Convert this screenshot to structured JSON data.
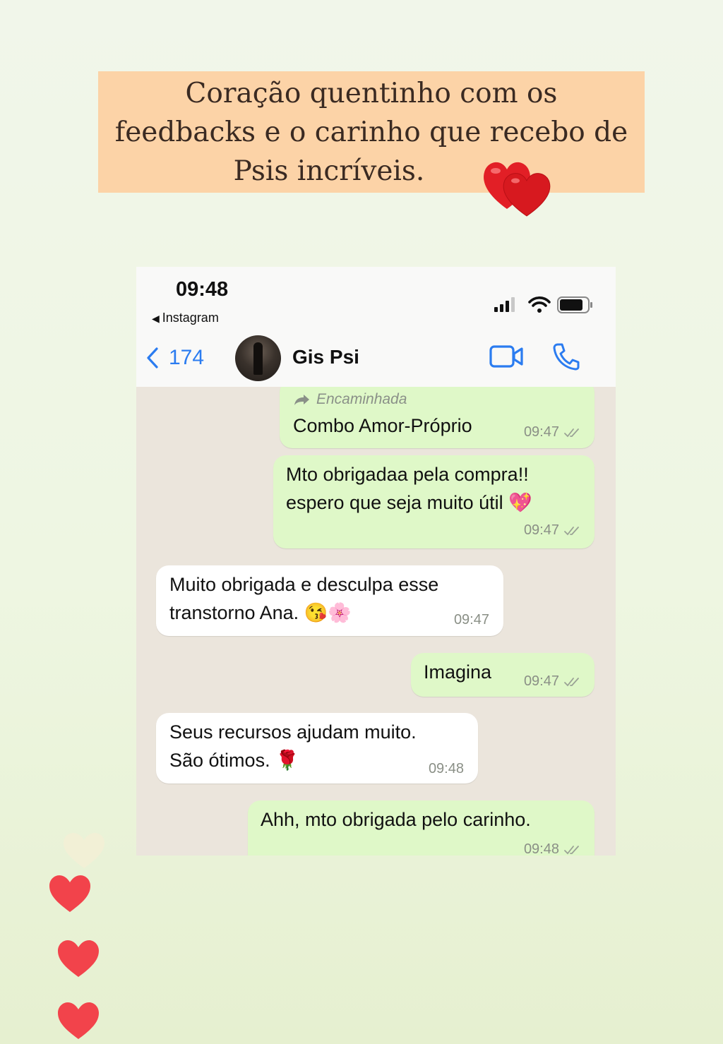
{
  "caption": {
    "lines": [
      "Coração quentinho com os",
      "feedbacks e o carinho que recebo de",
      "Psis incríveis."
    ]
  },
  "status_bar": {
    "time": "09:48",
    "back_app": "Instagram"
  },
  "chat_header": {
    "back_count": "174",
    "contact_name": "Gis Psi"
  },
  "messages": [
    {
      "side": "out",
      "forwarded_label": "Encaminhada",
      "lines": [
        "Combo Amor-Próprio"
      ],
      "time": "09:47"
    },
    {
      "side": "out",
      "lines": [
        "Mto obrigadaa pela compra!!",
        "espero que seja muito útil 💖"
      ],
      "time": "09:47"
    },
    {
      "side": "in",
      "lines": [
        "Muito obrigada e desculpa esse",
        "transtorno Ana. 😘🌸"
      ],
      "time": "09:47"
    },
    {
      "side": "out",
      "lines": [
        "Imagina"
      ],
      "time": "09:47"
    },
    {
      "side": "in",
      "lines": [
        "Seus recursos ajudam muito.",
        "São ótimos. 🌹"
      ],
      "time": "09:48"
    },
    {
      "side": "out",
      "lines": [
        "Ahh, mto obrigada pelo carinho."
      ],
      "time": "09:48"
    }
  ],
  "colors": {
    "caption_bg": "#fcd3a7",
    "outgoing_bubble": "#dff8c8",
    "incoming_bubble": "#ffffff",
    "link_blue": "#2b7cf0",
    "heart_red": "#f2434b"
  },
  "icons": [
    "hearts-icon",
    "signal-icon",
    "wifi-icon",
    "battery-icon",
    "chevron-left-icon",
    "video-call-icon",
    "phone-icon",
    "forward-arrow-icon",
    "double-check-icon",
    "heart-icon"
  ]
}
